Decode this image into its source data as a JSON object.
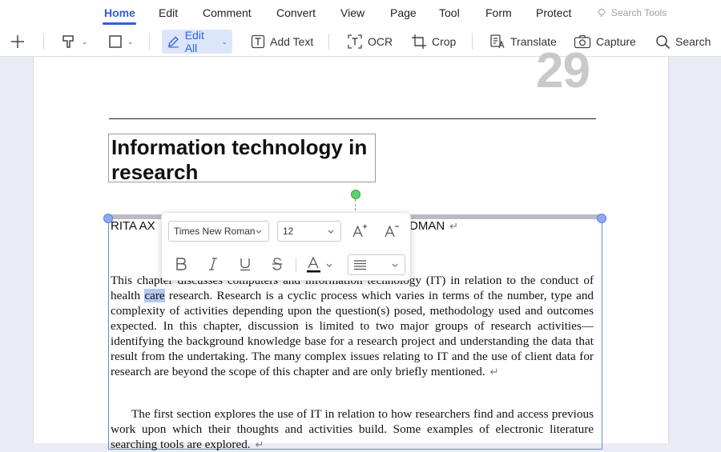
{
  "menu": {
    "items": [
      "Home",
      "Edit",
      "Comment",
      "Convert",
      "View",
      "Page",
      "Tool",
      "Form",
      "Protect"
    ],
    "active": "Home",
    "search_tools": "Search Tools"
  },
  "toolbar": {
    "edit_all": "Edit All",
    "add_text": "Add Text",
    "ocr": "OCR",
    "crop": "Crop",
    "translate": "Translate",
    "capture": "Capture",
    "search": "Search"
  },
  "document": {
    "page_number": "29",
    "title_line1": "Information technology in",
    "title_line2": "research",
    "authors_left": "RITA AX",
    "authors_right": "DMAN",
    "paragraph_mark": "↵",
    "p1_before": "This chapter discusses computers and information technology (IT) in relation to the conduct of health ",
    "p1_highlight": "care",
    "p1_after": " research.  Research is a cyclic process which varies in terms of the number, type and complexity of activities depending upon the question(s) posed, methodology used and outcomes expected.  In this chapter, discussion is limited to two major groups of research activities—identifying the background knowledge base for a research project and understanding the data that result from the undertaking.  The many complex issues relating to IT and the use of client data for research are beyond the scope of this chapter and are only briefly mentioned.",
    "p2": "The first section explores the use of IT in relation to how researchers find and access previous work upon which their thoughts and activities build.  Some examples of electronic literature searching tools are explored."
  },
  "format_toolbar": {
    "font": "Times New Roman",
    "size": "12",
    "text_color": "#000000"
  },
  "colors": {
    "accent": "#2f5ee0",
    "selection_highlight": "#b6c7f2",
    "rotation_handle": "#5dd16a"
  }
}
